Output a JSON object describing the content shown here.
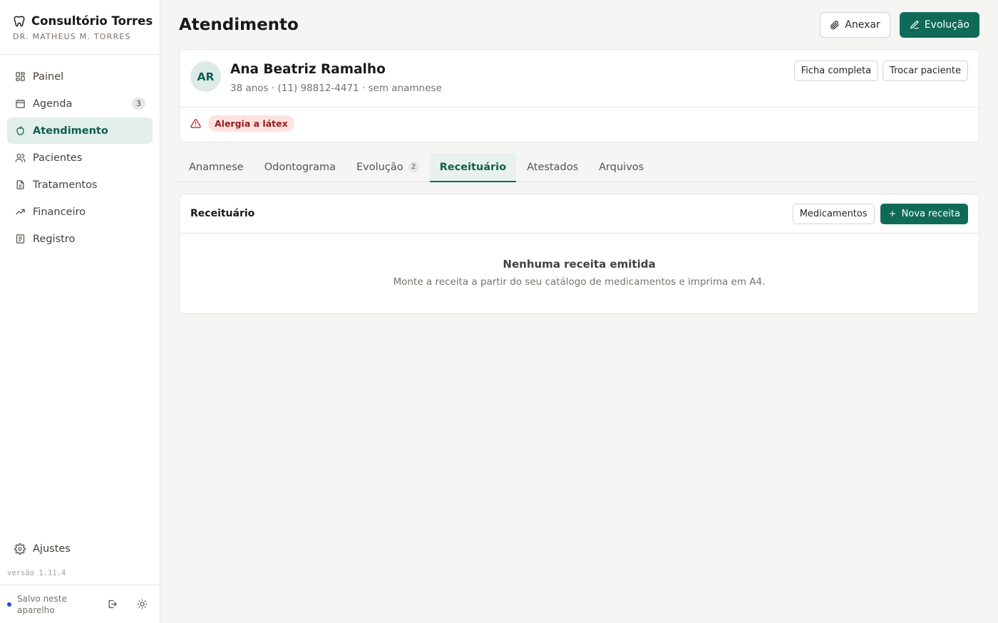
{
  "sidebar": {
    "brand_title": "Consultório Torres",
    "brand_subtitle": "DR. MATHEUS M. TORRES",
    "items": [
      {
        "label": "Painel"
      },
      {
        "label": "Agenda",
        "badge": "3"
      },
      {
        "label": "Atendimento"
      },
      {
        "label": "Pacientes"
      },
      {
        "label": "Tratamentos"
      },
      {
        "label": "Financeiro"
      },
      {
        "label": "Registro"
      }
    ],
    "settings_label": "Ajustes",
    "version": "versão 1.11.4",
    "saved_status": "Salvo neste aparelho"
  },
  "header": {
    "title": "Atendimento",
    "attach_label": "Anexar",
    "evolution_label": "Evolução"
  },
  "patient": {
    "initials": "AR",
    "name": "Ana Beatriz Ramalho",
    "meta": "38 anos · (11) 98812-4471 · sem anamnese",
    "full_record_label": "Ficha completa",
    "switch_label": "Trocar paciente",
    "alert": "Alergia a látex"
  },
  "tabs": [
    {
      "label": "Anamnese"
    },
    {
      "label": "Odontograma"
    },
    {
      "label": "Evolução",
      "count": "2"
    },
    {
      "label": "Receituário"
    },
    {
      "label": "Atestados"
    },
    {
      "label": "Arquivos"
    }
  ],
  "prescriptions": {
    "title": "Receituário",
    "medications_label": "Medicamentos",
    "new_label": "Nova receita",
    "empty_title": "Nenhuma receita emitida",
    "empty_subtitle": "Monte a receita a partir do seu catálogo de medicamentos e imprima em A4."
  },
  "colors": {
    "accent": "#0f6b58",
    "active_bg": "#e2efea",
    "alert_bg": "#fde2e1",
    "alert_text": "#991b1b"
  }
}
